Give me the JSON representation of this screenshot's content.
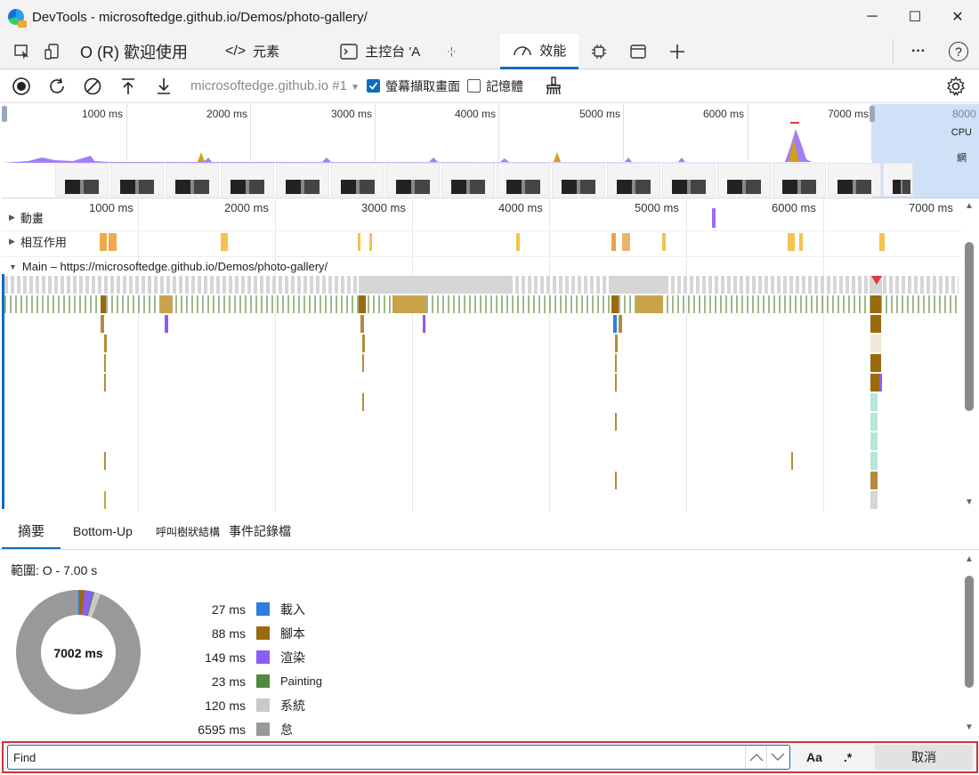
{
  "window": {
    "title": "DevTools - microsoftedge.github.io/Demos/photo-gallery/",
    "minimize_glyph": "─",
    "maximize_glyph": "☐",
    "close_glyph": "✕"
  },
  "tabs": {
    "welcome": "O (R) 歡迎使用",
    "elements": "元素",
    "console": "主控台 'A",
    "sources_glyph": "·¦·",
    "performance": "效能",
    "more_glyph": "···",
    "help_glyph": "?"
  },
  "toolbar": {
    "url_select": "microsoftedge.github.io #1",
    "screenshots_label": "螢幕擷取畫面",
    "screenshots_checked": true,
    "memory_label": "記憶體",
    "memory_checked": false
  },
  "overview": {
    "ticks": [
      "1000 ms",
      "2000 ms",
      "3000 ms",
      "4000 ms",
      "5000 ms",
      "6000 ms",
      "7000 ms",
      "8000"
    ],
    "cpu_label": "CPU",
    "net_label": "網"
  },
  "flame": {
    "ticks": [
      "1000 ms",
      "2000 ms",
      "3000 ms",
      "4000 ms",
      "5000 ms",
      "6000 ms",
      "7000 ms"
    ],
    "tracks": {
      "animations": "動畫",
      "interactions": "相互作用",
      "main": "Main – https://microsoftedge.github.io/Demos/photo-gallery/"
    }
  },
  "bottom_tabs": [
    "摘要",
    "Bottom-Up",
    "呼叫樹狀結構",
    "事件記錄檔"
  ],
  "summary": {
    "range": "範圍: O - 7.00 s",
    "total": "7002 ms",
    "legend": [
      {
        "value": "27 ms",
        "label": "載入",
        "color": "#2e7de1"
      },
      {
        "value": "88 ms",
        "label": "腳本",
        "color": "#9a6a0d"
      },
      {
        "value": "149 ms",
        "label": "渲染",
        "color": "#8b5cf6"
      },
      {
        "value": "23 ms",
        "label": "Painting",
        "color": "#4f8b3a"
      },
      {
        "value": "120 ms",
        "label": "系統",
        "color": "#c9c9c9"
      },
      {
        "value": "6595 ms",
        "label": "怠",
        "color": "#999999"
      }
    ]
  },
  "find": {
    "placeholder": "Find",
    "match_case": "Aa",
    "regex": ".*",
    "cancel": "取消"
  }
}
